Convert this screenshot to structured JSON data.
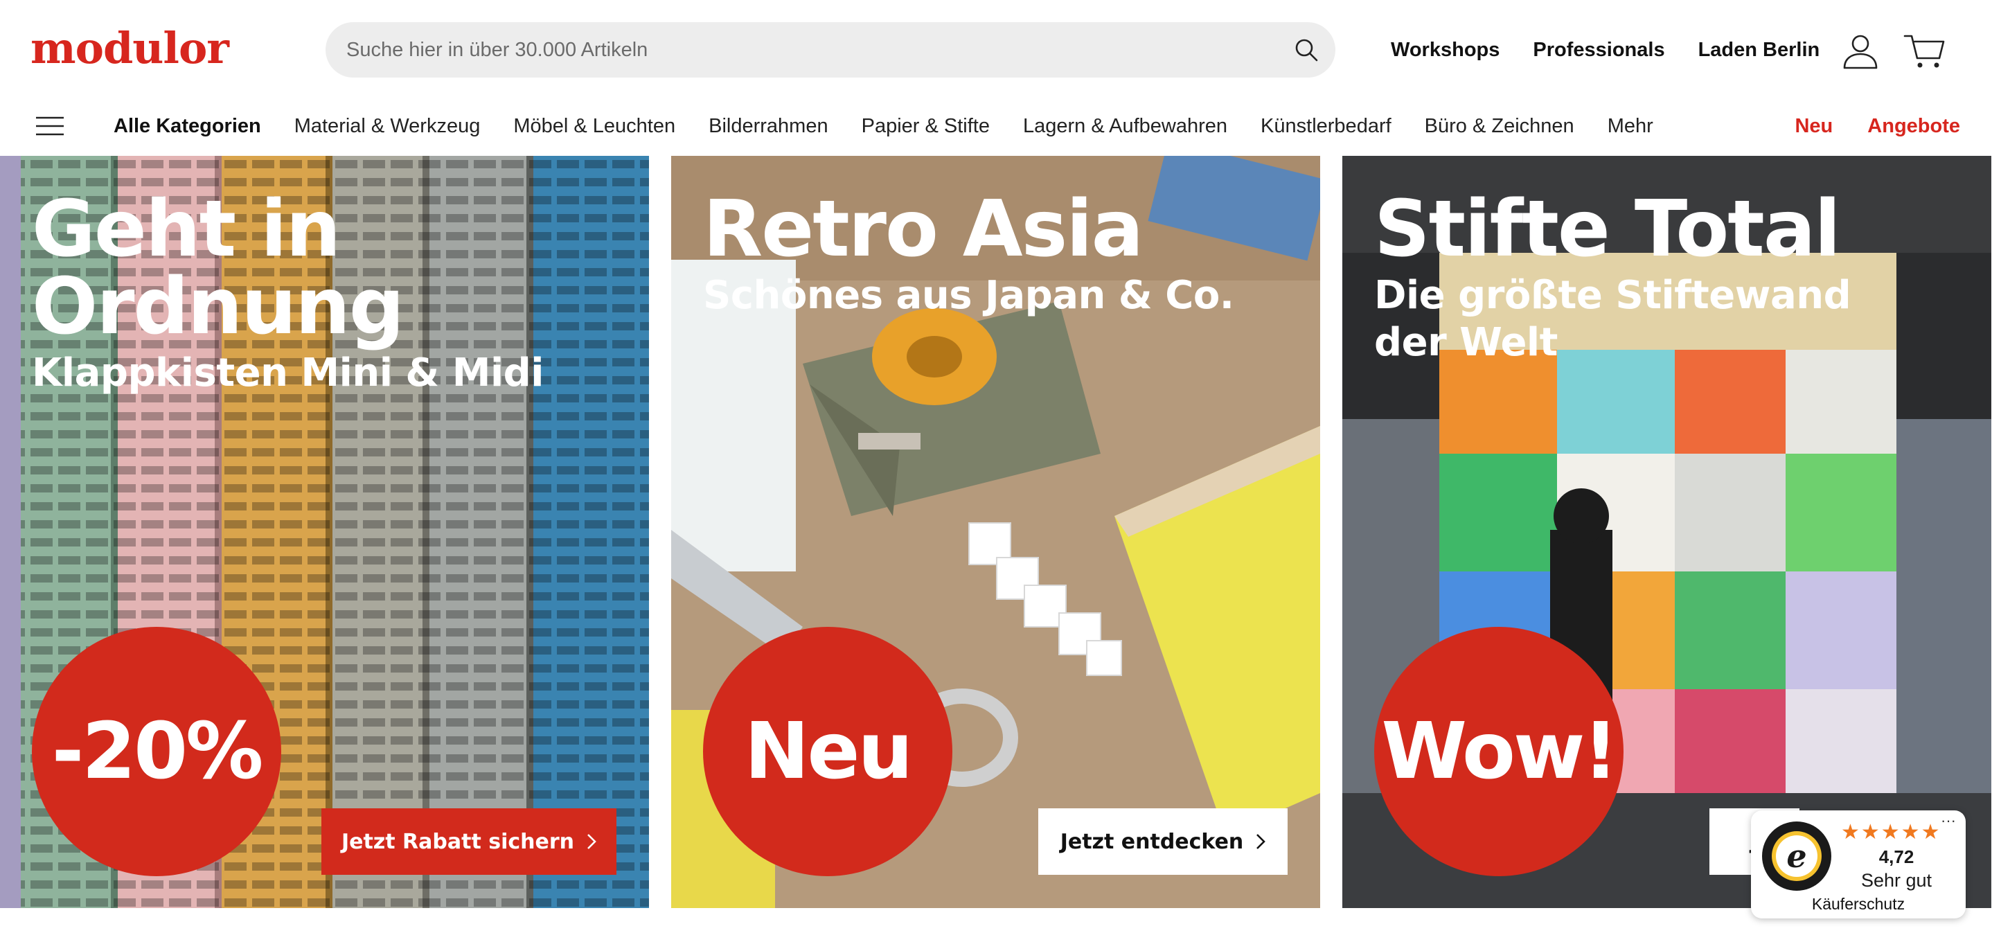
{
  "header": {
    "logo": "modulor",
    "search_placeholder": "Suche hier in über 30.000 Artikeln",
    "links": [
      "Workshops",
      "Professionals",
      "Laden Berlin"
    ]
  },
  "nav": {
    "items": [
      "Alle Kategorien",
      "Material & Werkzeug",
      "Möbel & Leuchten",
      "Bilderrahmen",
      "Papier & Stifte",
      "Lagern & Aufbewahren",
      "Künstlerbedarf",
      "Büro & Zeichnen",
      "Mehr"
    ],
    "highlights": [
      "Neu",
      "Angebote"
    ]
  },
  "banners": [
    {
      "title": "Geht in Ordnung",
      "subtitle": "Klappkisten Mini & Midi",
      "badge": "-20%",
      "cta": "Jetzt Rabatt sichern"
    },
    {
      "title": "Retro Asia",
      "subtitle": "Schönes aus Japan & Co.",
      "badge": "Neu",
      "cta": "Jetzt entdecken"
    },
    {
      "title": "Stifte Total",
      "subtitle": "Die größte Stiftewand der Welt",
      "badge": "Wow!",
      "cta": "J"
    }
  ],
  "trusted_shops": {
    "stars": "★★★★★",
    "score": "4,72",
    "label": "Sehr gut",
    "footer": "Käuferschutz",
    "more": "···"
  },
  "colors": {
    "brand_red": "#d7261e",
    "badge_red": "#d22a1c",
    "star_orange": "#f0791f"
  }
}
